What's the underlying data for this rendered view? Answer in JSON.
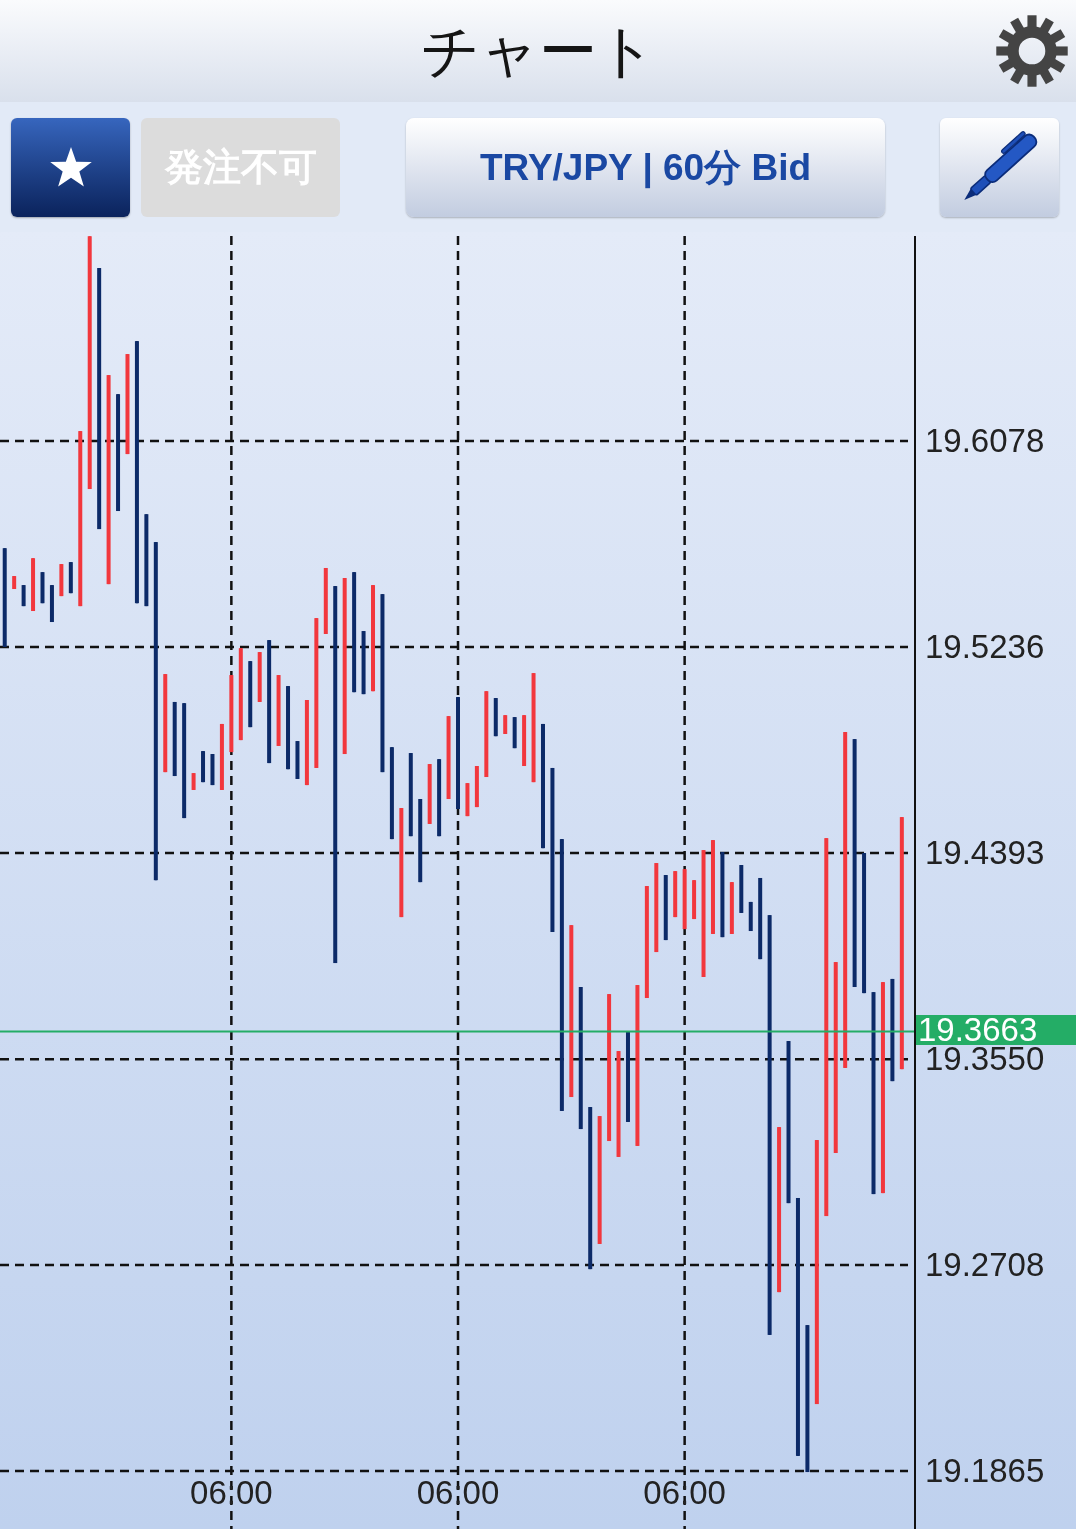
{
  "header": {
    "title": "チャート"
  },
  "toolbar": {
    "order_button": {
      "label": "発注不可",
      "disabled": true
    },
    "symbol_button": {
      "label": "TRY/JPY | 60分 Bid"
    }
  },
  "chart": {
    "chart_data": {
      "type": "candlestick",
      "grid": true,
      "ylim": [
        19.1628,
        19.6917
      ],
      "yticks": [
        {
          "value": 19.6078,
          "label": "19.6078"
        },
        {
          "value": 19.5236,
          "label": "19.5236"
        },
        {
          "value": 19.4393,
          "label": "19.4393"
        },
        {
          "value": 19.355,
          "label": "19.3550"
        },
        {
          "value": 19.2708,
          "label": "19.2708"
        },
        {
          "value": 19.1865,
          "label": "19.1865"
        }
      ],
      "categories": [
        null,
        null,
        null,
        null,
        null,
        null,
        null,
        null,
        null,
        null,
        null,
        null,
        null,
        null,
        null,
        null,
        null,
        null,
        null,
        null,
        null,
        null,
        null,
        null,
        "06:00",
        null,
        null,
        null,
        null,
        null,
        null,
        null,
        null,
        null,
        null,
        null,
        null,
        null,
        null,
        null,
        null,
        null,
        null,
        null,
        null,
        null,
        null,
        null,
        "06:00",
        null,
        null,
        null,
        null,
        null,
        null,
        null,
        null,
        null,
        null,
        null,
        null,
        null,
        null,
        null,
        null,
        null,
        null,
        null,
        null,
        null,
        null,
        null,
        "06:00",
        null,
        null,
        null,
        null,
        null,
        null,
        null,
        null,
        null,
        null,
        null,
        null,
        null,
        null,
        null,
        null,
        null,
        null,
        null,
        null,
        null,
        null,
        null,
        null
      ],
      "series": [
        {
          "ohlc": [
            [
              19.564,
              19.564,
              19.5236,
              19.5236
            ],
            [
              19.5473,
              19.5526,
              19.5473,
              19.5526
            ],
            [
              19.5489,
              19.5489,
              19.5403,
              19.5403
            ],
            [
              19.5383,
              19.5599,
              19.5383,
              19.5599
            ],
            [
              19.5542,
              19.5542,
              19.5415,
              19.5415
            ],
            [
              19.5489,
              19.5489,
              19.5338,
              19.5338
            ],
            [
              19.5444,
              19.5575,
              19.5444,
              19.5575
            ],
            [
              19.5583,
              19.5583,
              19.5456,
              19.5456
            ],
            [
              19.5403,
              19.6119,
              19.5403,
              19.6119
            ],
            [
              19.5882,
              19.6916,
              19.5882,
              19.6916
            ],
            [
              19.6786,
              19.6786,
              19.5718,
              19.5718
            ],
            [
              19.5493,
              19.6348,
              19.5493,
              19.6348
            ],
            [
              19.627,
              19.627,
              19.5792,
              19.5792
            ],
            [
              19.6025,
              19.6434,
              19.6025,
              19.6434
            ],
            [
              19.6487,
              19.6487,
              19.5415,
              19.5415
            ],
            [
              19.5779,
              19.5779,
              19.5403,
              19.5403
            ],
            [
              19.5665,
              19.5665,
              19.4282,
              19.4282
            ],
            [
              19.4724,
              19.5125,
              19.4724,
              19.5125
            ],
            [
              19.5011,
              19.5011,
              19.4708,
              19.4708
            ],
            [
              19.5006,
              19.5006,
              19.4536,
              19.4536
            ],
            [
              19.4651,
              19.472,
              19.4651,
              19.472
            ],
            [
              19.481,
              19.481,
              19.4683,
              19.4683
            ],
            [
              19.4798,
              19.4798,
              19.4671,
              19.4671
            ],
            [
              19.4651,
              19.4921,
              19.4651,
              19.4921
            ],
            [
              19.4806,
              19.5121,
              19.4806,
              19.5121
            ],
            [
              19.4855,
              19.5231,
              19.4855,
              19.5231
            ],
            [
              19.5178,
              19.5178,
              19.4908,
              19.4908
            ],
            [
              19.5011,
              19.5215,
              19.5011,
              19.5215
            ],
            [
              19.5264,
              19.5264,
              19.4761,
              19.4761
            ],
            [
              19.4831,
              19.5121,
              19.4831,
              19.5121
            ],
            [
              19.5076,
              19.5076,
              19.4736,
              19.4736
            ],
            [
              19.4851,
              19.4851,
              19.4696,
              19.4696
            ],
            [
              19.4671,
              19.5019,
              19.4671,
              19.5019
            ],
            [
              19.4741,
              19.5354,
              19.4741,
              19.5354
            ],
            [
              19.5289,
              19.5559,
              19.5289,
              19.5559
            ],
            [
              19.5485,
              19.5485,
              19.3943,
              19.3943
            ],
            [
              19.4798,
              19.5518,
              19.4798,
              19.5518
            ],
            [
              19.5542,
              19.5542,
              19.5051,
              19.5051
            ],
            [
              19.5301,
              19.5301,
              19.5043,
              19.5043
            ],
            [
              19.5055,
              19.5489,
              19.5055,
              19.5489
            ],
            [
              19.5452,
              19.5452,
              19.4724,
              19.4724
            ],
            [
              19.4826,
              19.4826,
              19.445,
              19.445
            ],
            [
              19.4131,
              19.4577,
              19.4131,
              19.4577
            ],
            [
              19.4802,
              19.4802,
              19.4462,
              19.4462
            ],
            [
              19.4614,
              19.4614,
              19.4274,
              19.4274
            ],
            [
              19.4512,
              19.4757,
              19.4512,
              19.4757
            ],
            [
              19.4777,
              19.4777,
              19.4462,
              19.4462
            ],
            [
              19.4614,
              19.4953,
              19.4614,
              19.4953
            ],
            [
              19.5031,
              19.5031,
              19.4573,
              19.4573
            ],
            [
              19.4544,
              19.4679,
              19.4544,
              19.4679
            ],
            [
              19.4581,
              19.4749,
              19.4581,
              19.4749
            ],
            [
              19.4704,
              19.5055,
              19.4704,
              19.5055
            ],
            [
              19.5027,
              19.5027,
              19.4871,
              19.4871
            ],
            [
              19.488,
              19.4957,
              19.488,
              19.4957
            ],
            [
              19.4949,
              19.4949,
              19.4822,
              19.4822
            ],
            [
              19.4749,
              19.4957,
              19.4749,
              19.4957
            ],
            [
              19.4683,
              19.5129,
              19.4683,
              19.5129
            ],
            [
              19.4921,
              19.4921,
              19.4413,
              19.4413
            ],
            [
              19.4741,
              19.4741,
              19.407,
              19.407
            ],
            [
              19.445,
              19.445,
              19.3338,
              19.3338
            ],
            [
              19.3395,
              19.4098,
              19.3395,
              19.4098
            ],
            [
              19.3845,
              19.3845,
              19.3264,
              19.3264
            ],
            [
              19.3354,
              19.3354,
              19.2691,
              19.2691
            ],
            [
              19.2794,
              19.3317,
              19.2794,
              19.3317
            ],
            [
              19.3215,
              19.3816,
              19.3215,
              19.3816
            ],
            [
              19.315,
              19.3583,
              19.315,
              19.3583
            ],
            [
              19.3661,
              19.3661,
              19.3293,
              19.3293
            ],
            [
              19.3195,
              19.3853,
              19.3195,
              19.3853
            ],
            [
              19.38,
              19.4258,
              19.38,
              19.4258
            ],
            [
              19.3988,
              19.4352,
              19.3988,
              19.4352
            ],
            [
              19.4303,
              19.4303,
              19.4037,
              19.4037
            ],
            [
              19.4131,
              19.4319,
              19.4131,
              19.4319
            ],
            [
              19.4082,
              19.4327,
              19.4082,
              19.4327
            ],
            [
              19.4123,
              19.4282,
              19.4123,
              19.4282
            ],
            [
              19.3886,
              19.4405,
              19.3886,
              19.4405
            ],
            [
              19.4062,
              19.4446,
              19.4062,
              19.4446
            ],
            [
              19.4397,
              19.4397,
              19.4049,
              19.4049
            ],
            [
              19.4062,
              19.4274,
              19.4062,
              19.4274
            ],
            [
              19.4344,
              19.4344,
              19.4148,
              19.4148
            ],
            [
              19.4193,
              19.4193,
              19.4074,
              19.4074
            ],
            [
              19.4291,
              19.4291,
              19.3959,
              19.3959
            ],
            [
              19.4139,
              19.4139,
              19.2422,
              19.2422
            ],
            [
              19.2597,
              19.3272,
              19.2597,
              19.3272
            ],
            [
              19.3624,
              19.3624,
              19.2961,
              19.2961
            ],
            [
              19.2982,
              19.2982,
              19.1927,
              19.1927
            ],
            [
              19.2462,
              19.2462,
              19.1861,
              19.1861
            ],
            [
              19.2139,
              19.3219,
              19.2139,
              19.3219
            ],
            [
              19.2908,
              19.4454,
              19.2908,
              19.4454
            ],
            [
              19.3166,
              19.3947,
              19.3166,
              19.3947
            ],
            [
              19.3514,
              19.4888,
              19.3514,
              19.4888
            ],
            [
              19.4859,
              19.4859,
              19.3845,
              19.3845
            ],
            [
              19.4393,
              19.4393,
              19.382,
              19.382
            ],
            [
              19.3824,
              19.3824,
              19.2998,
              19.2998
            ],
            [
              19.3002,
              19.3865,
              19.3002,
              19.3865
            ],
            [
              19.3878,
              19.3878,
              19.346,
              19.346
            ],
            [
              19.3509,
              19.454,
              19.3509,
              19.454
            ],
            null
          ]
        }
      ],
      "ref_lines": [
        {
          "axis": "y",
          "value": 19.3663,
          "label": "19.3663",
          "color": "#24ad66"
        }
      ]
    }
  }
}
